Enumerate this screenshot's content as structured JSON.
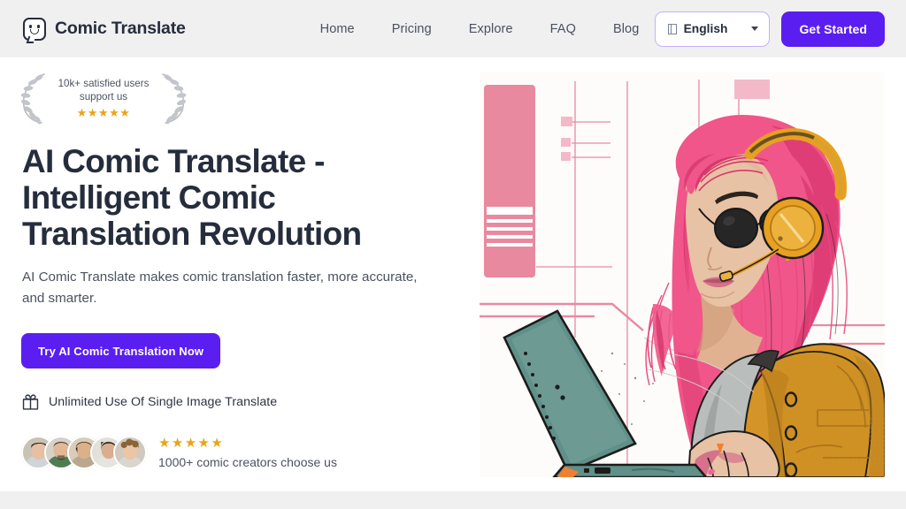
{
  "header": {
    "brand": "Comic Translate",
    "logo_icon": "comic-bubble-smiley-icon",
    "nav": [
      {
        "label": "Home"
      },
      {
        "label": "Pricing"
      },
      {
        "label": "Explore"
      },
      {
        "label": "FAQ"
      },
      {
        "label": "Blog"
      }
    ],
    "language": {
      "value": "English",
      "flag_icon": "flag-placeholder-icon",
      "caret_icon": "chevron-down-icon"
    },
    "cta": "Get Started",
    "bg_color": "#f0f0f0",
    "accent_color": "#5a1ef0"
  },
  "hero": {
    "badge": {
      "line1": "10k+ satisfied users",
      "line2": "support us",
      "stars": "★★★★★",
      "star_color": "#e8a41a",
      "left_icon": "laurel-wreath-left-icon",
      "right_icon": "laurel-wreath-right-icon"
    },
    "headline": "AI Comic Translate - Intelligent Comic Translation Revolution",
    "subhead": "AI Comic Translate makes comic translation faster, more accurate, and smarter.",
    "cta": "Try AI Comic Translation Now",
    "perk": {
      "icon": "gift-icon",
      "text": "Unlimited Use Of Single Image Translate"
    },
    "social_proof": {
      "stars": "★★★★★",
      "text": "1000+ comic creators choose us",
      "avatar_count": 5,
      "avatars": [
        {
          "name": "avatar-1",
          "skin": "#e7bfa4",
          "hair": "#3c2c22",
          "shirt": "#cfd4d8",
          "bg": "#c9c2b6"
        },
        {
          "name": "avatar-2",
          "skin": "#e3b896",
          "hair": "#2f2620",
          "shirt": "#4f7d52",
          "bg": "#d6d2c8"
        },
        {
          "name": "avatar-3",
          "skin": "#dcb089",
          "hair": "#231b16",
          "shirt": "#b9a88f",
          "bg": "#d9cdb9"
        },
        {
          "name": "avatar-4",
          "skin": "#d8ae8e",
          "hair": "#2b2420",
          "shirt": "#e6e4e0",
          "bg": "#e3e0da"
        },
        {
          "name": "avatar-5",
          "skin": "#e9c6a6",
          "hair": "#8a6436",
          "shirt": "#dad6cf",
          "bg": "#cfc9bf"
        }
      ]
    },
    "illustration": {
      "name": "comic-woman-with-laptop-illustration",
      "alt": "Comic-style illustration of a woman with pink hair, sunglasses, orange headphones and mustard jacket typing on a teal laptop",
      "colors": {
        "hair": "#f0568a",
        "hair_dark": "#d8376d",
        "headphones": "#e8a020",
        "jacket": "#d49427",
        "laptop": "#5f9089",
        "skin": "#e8c2a4",
        "background_pink": "#e9899f",
        "background_pink_light": "#f3b9c8",
        "canvas": "#fdfcfb"
      }
    }
  },
  "footer_band_color": "#f0f0f0"
}
